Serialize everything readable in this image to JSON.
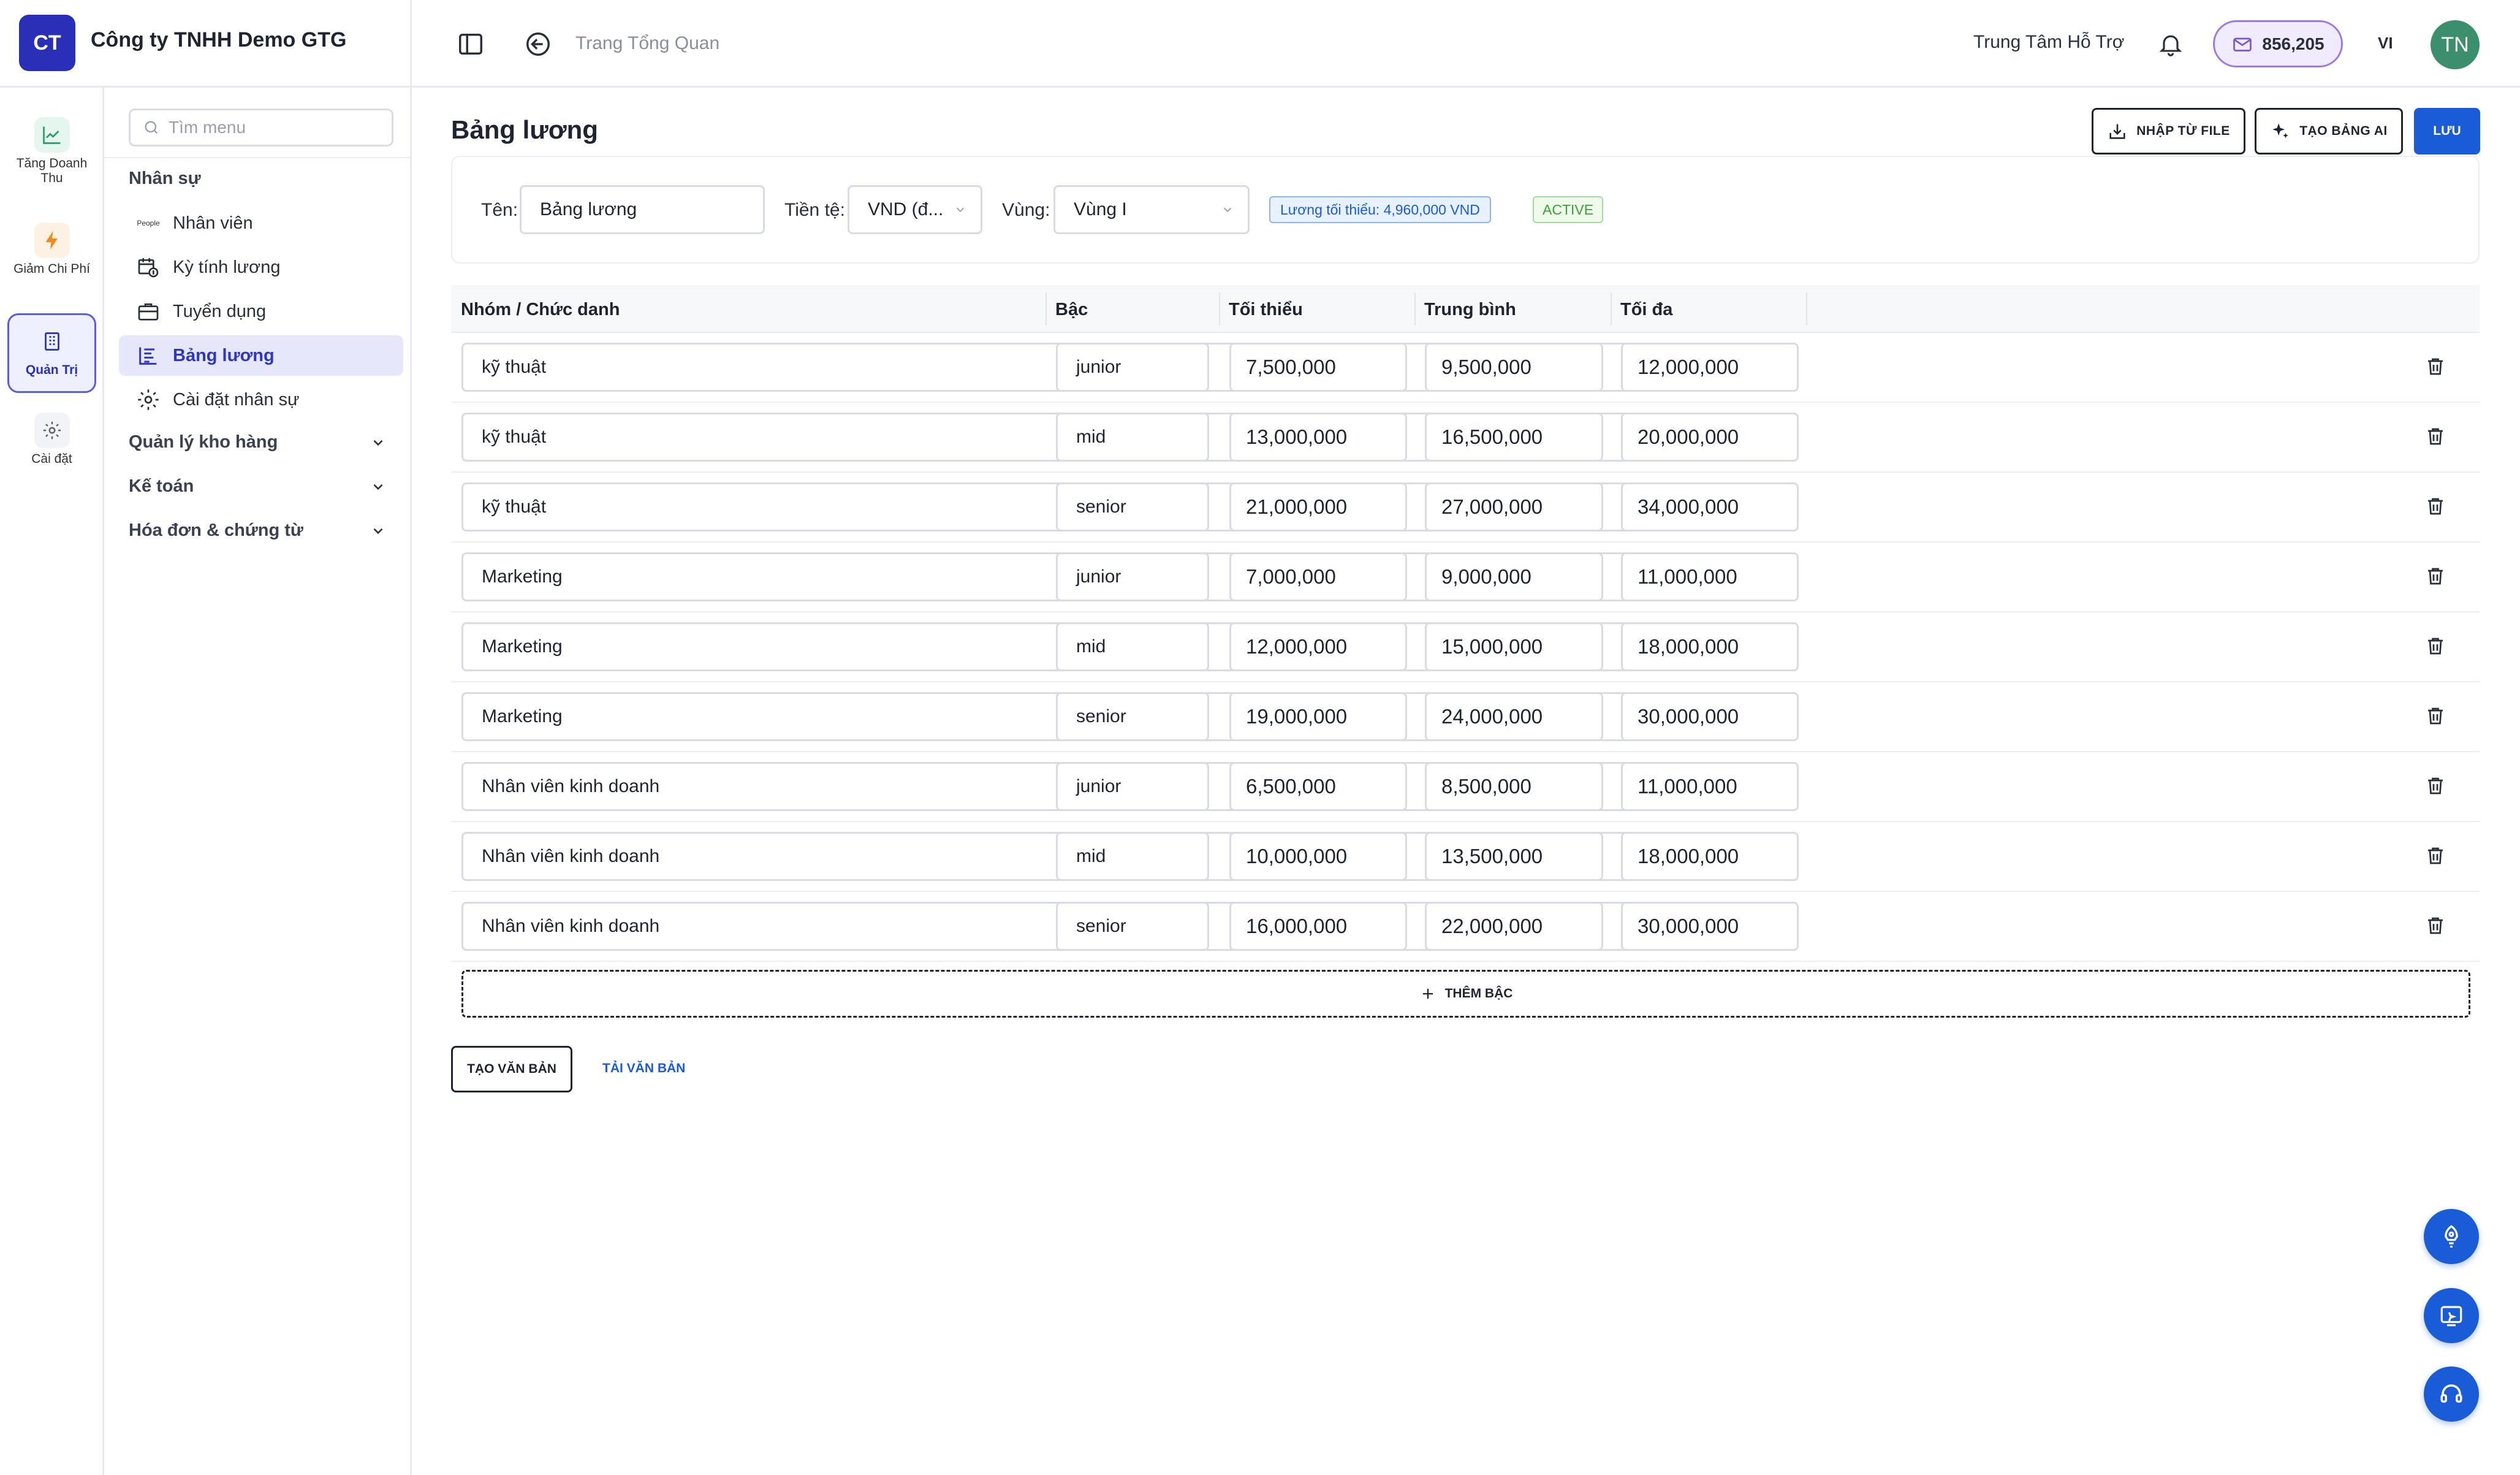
{
  "header": {
    "logo_initials": "CT",
    "company_name": "Công ty TNHH Demo GTG",
    "breadcrumb": "Trang Tổng Quan",
    "support_label": "Trung Tâm Hỗ Trợ",
    "balance": "856,205",
    "language": "VI",
    "avatar_initials": "TN",
    "accent_color": "#2a2fb8",
    "balance_border_color": "#9a7be6"
  },
  "rail": {
    "items": [
      {
        "label": "Tăng Doanh Thu",
        "icon": "trending-up-icon"
      },
      {
        "label": "Giảm Chi Phí",
        "icon": "lightning-icon"
      },
      {
        "label": "Quản Trị",
        "icon": "building-icon"
      },
      {
        "label": "Cài đặt",
        "icon": "gear-icon"
      }
    ]
  },
  "menu": {
    "search_placeholder": "Tìm menu",
    "section_hr": "Nhân sự",
    "items": [
      {
        "label": "Nhân viên",
        "icon_text": "People"
      },
      {
        "label": "Kỳ tính lương"
      },
      {
        "label": "Tuyển dụng"
      },
      {
        "label": "Bảng lương"
      },
      {
        "label": "Cài đặt nhân sự"
      }
    ],
    "sections": [
      {
        "label": "Quản lý kho hàng"
      },
      {
        "label": "Kế toán"
      },
      {
        "label": "Hóa đơn & chứng từ"
      }
    ]
  },
  "page": {
    "title": "Bảng lương",
    "import_label": "NHẬP TỪ FILE",
    "ai_label": "TẠO BẢNG AI",
    "save_label": "LƯU"
  },
  "form": {
    "name_label": "Tên:",
    "name_value": "Bảng lương",
    "currency_label": "Tiền tệ:",
    "currency_value": "VND (đ...",
    "region_label": "Vùng:",
    "region_value": "Vùng I",
    "min_wage_tag": "Lương tối thiểu: 4,960,000 VND",
    "status_tag": "ACTIVE"
  },
  "table": {
    "headers": [
      "Nhóm / Chức danh",
      "Bậc",
      "Tối thiểu",
      "Trung bình",
      "Tối đa"
    ],
    "rows": [
      {
        "group": "kỹ thuật",
        "level": "junior",
        "min": "7,500,000",
        "mid": "9,500,000",
        "max": "12,000,000"
      },
      {
        "group": "kỹ thuật",
        "level": "mid",
        "min": "13,000,000",
        "mid": "16,500,000",
        "max": "20,000,000"
      },
      {
        "group": "kỹ thuật",
        "level": "senior",
        "min": "21,000,000",
        "mid": "27,000,000",
        "max": "34,000,000"
      },
      {
        "group": "Marketing",
        "level": "junior",
        "min": "7,000,000",
        "mid": "9,000,000",
        "max": "11,000,000"
      },
      {
        "group": "Marketing",
        "level": "mid",
        "min": "12,000,000",
        "mid": "15,000,000",
        "max": "18,000,000"
      },
      {
        "group": "Marketing",
        "level": "senior",
        "min": "19,000,000",
        "mid": "24,000,000",
        "max": "30,000,000"
      },
      {
        "group": "Nhân viên kinh doanh",
        "level": "junior",
        "min": "6,500,000",
        "mid": "8,500,000",
        "max": "11,000,000"
      },
      {
        "group": "Nhân viên kinh doanh",
        "level": "mid",
        "min": "10,000,000",
        "mid": "13,500,000",
        "max": "18,000,000"
      },
      {
        "group": "Nhân viên kinh doanh",
        "level": "senior",
        "min": "16,000,000",
        "mid": "22,000,000",
        "max": "30,000,000"
      }
    ],
    "add_level_label": "THÊM BẬC"
  },
  "footer": {
    "create_doc_label": "TẠO VĂN BẢN",
    "download_doc_label": "TẢI VĂN BẢN"
  },
  "fabs": [
    {
      "icon": "rocket-icon"
    },
    {
      "icon": "ai-assistant-icon"
    },
    {
      "icon": "headset-icon"
    }
  ]
}
